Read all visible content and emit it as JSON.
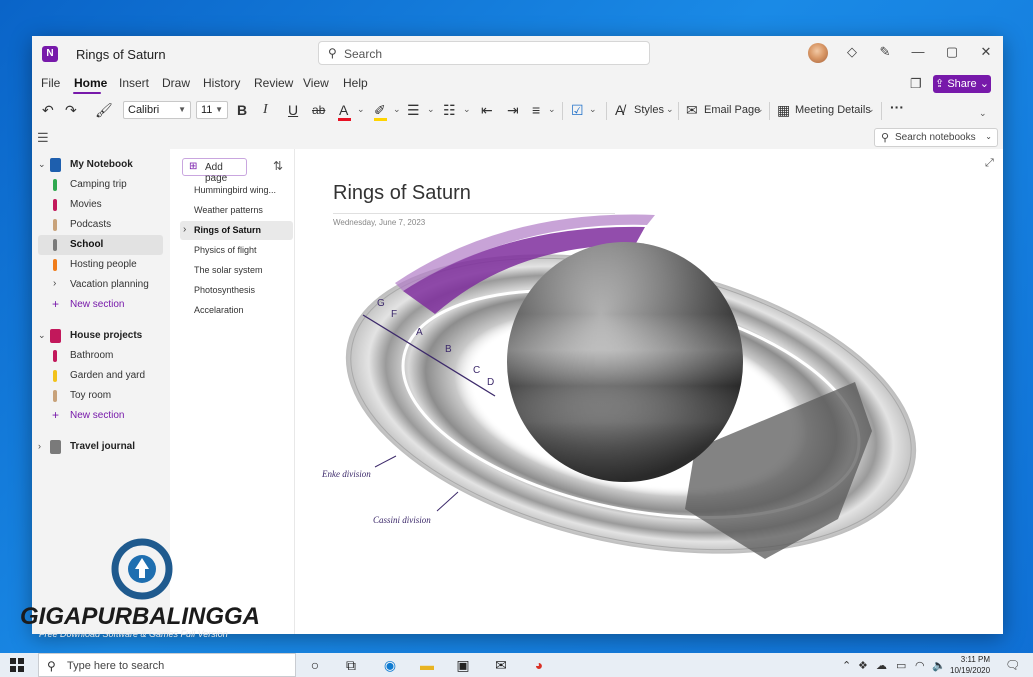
{
  "window": {
    "title": "Rings of Saturn",
    "search_placeholder": "Search",
    "controls": {
      "minimize": "—",
      "maximize": "▢",
      "close": "✕"
    }
  },
  "menu": {
    "items": [
      "File",
      "Home",
      "Insert",
      "Draw",
      "History",
      "Review",
      "View",
      "Help"
    ],
    "active": "Home",
    "share_label": "Share"
  },
  "ribbon": {
    "font_name": "Calibri",
    "font_size": "11",
    "bold": "B",
    "italic": "I",
    "underline": "U",
    "strike": "ab",
    "font_color_letter": "A",
    "styles_label": "Styles",
    "email_label": "Email Page",
    "meeting_label": "Meeting Details",
    "more": "···",
    "colors": {
      "font": "#e81123",
      "highlight": "#ffd400",
      "accent": "#7719aa"
    }
  },
  "search_notebooks": {
    "placeholder": "Search notebooks"
  },
  "notebooks": [
    {
      "name": "My Notebook",
      "color": "#1e5fae",
      "expanded": true,
      "sections": [
        {
          "label": "Camping trip",
          "color": "#2fa84f"
        },
        {
          "label": "Movies",
          "color": "#c2185b"
        },
        {
          "label": "Podcasts",
          "color": "#c8a27a"
        },
        {
          "label": "School",
          "color": "#7a7a7a",
          "selected": true
        },
        {
          "label": "Hosting people",
          "color": "#f07c1a"
        },
        {
          "label": "Vacation planning",
          "group": true
        }
      ],
      "new_section": "New section"
    },
    {
      "name": "House projects",
      "color": "#c2185b",
      "expanded": true,
      "sections": [
        {
          "label": "Bathroom",
          "color": "#c2185b"
        },
        {
          "label": "Garden and yard",
          "color": "#f2c21b"
        },
        {
          "label": "Toy room",
          "color": "#c8a27a"
        }
      ],
      "new_section": "New section"
    },
    {
      "name": "Travel journal",
      "color": "#7a7a7a",
      "expanded": false
    }
  ],
  "pages": {
    "add_label": "Add page",
    "items": [
      "Hummingbird wing...",
      "Weather patterns",
      "Rings of Saturn",
      "Physics of flight",
      "The solar system",
      "Photosynthesis",
      "Accelaration"
    ],
    "selected": "Rings of Saturn"
  },
  "page": {
    "title": "Rings of Saturn",
    "date": "Wednesday, June 7, 2023",
    "ring_labels": [
      "G",
      "F",
      "A",
      "B",
      "C",
      "D"
    ],
    "annotations": {
      "encke": "Enke division",
      "cassini": "Cassini division"
    }
  },
  "watermark": {
    "brand": "GIGAPURBALINGGA",
    "tagline": "Free Download Software & Games Full Version"
  },
  "taskbar": {
    "search_placeholder": "Type here to search",
    "time": "3:11 PM",
    "date": "10/19/2020"
  }
}
